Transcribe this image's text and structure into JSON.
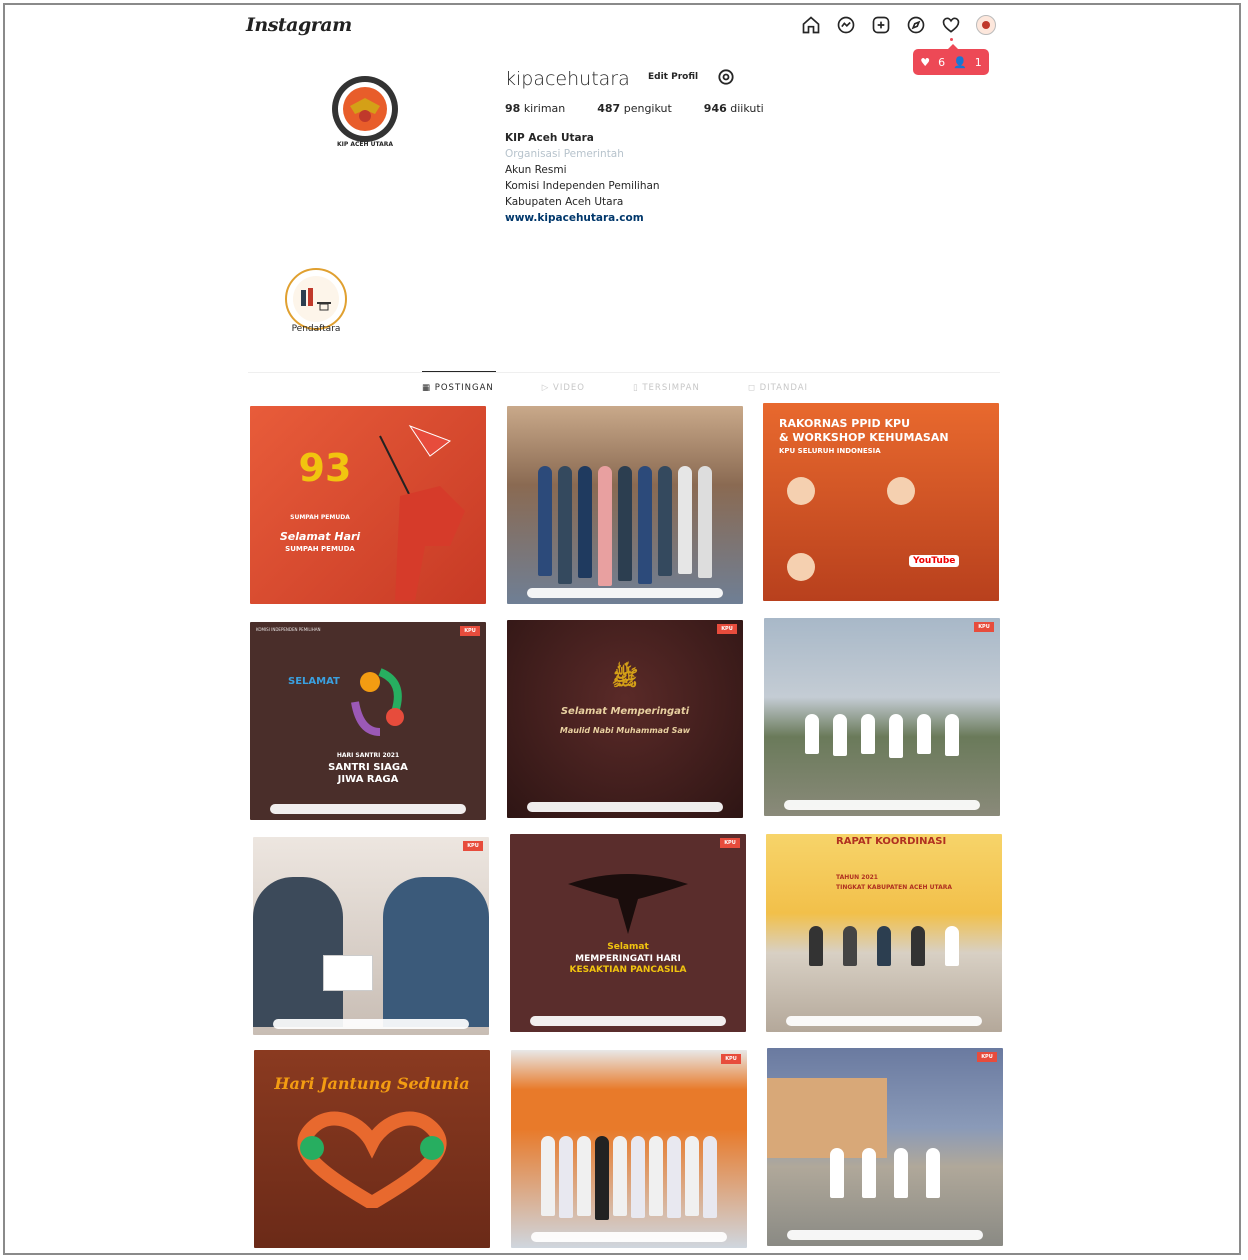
{
  "app": {
    "logo": "Instagram"
  },
  "nav": {
    "icons": [
      "home-icon",
      "messenger-icon",
      "new-post-icon",
      "explore-icon",
      "activity-heart-icon",
      "avatar"
    ]
  },
  "notification": {
    "likes": "6",
    "follows": "1"
  },
  "profile": {
    "username": "kipacehutara",
    "edit_label": "Edit Profil",
    "avatar_caption": "KIP ACEH UTARA",
    "stats": {
      "posts_count": "98",
      "posts_label": "kiriman",
      "followers_count": "487",
      "followers_label": "pengikut",
      "following_count": "946",
      "following_label": "diikuti"
    },
    "bio": {
      "name": "KIP Aceh Utara",
      "category": "Organisasi Pemerintah",
      "line1": "Akun Resmi",
      "line2": "Komisi Independen Pemilihan",
      "line3": "Kabupaten Aceh Utara",
      "link": "www.kipacehutara.com"
    }
  },
  "highlight": {
    "label": "Pendaftara"
  },
  "tabs": [
    {
      "label": "POSTINGAN",
      "active": true
    },
    {
      "label": "VIDEO",
      "active": false
    },
    {
      "label": "TERSIMPAN",
      "active": false
    },
    {
      "label": "DITANDAI",
      "active": false
    }
  ],
  "posts": {
    "p1": {
      "num": "93",
      "line1": "SUMPAH PEMUDA",
      "line2": "Selamat Hari",
      "line3": "SUMPAH PEMUDA"
    },
    "p3": {
      "line1": "RAKORNAS PPID KPU",
      "line2": "& WORKSHOP KEHUMASAN",
      "line3": "KPU SELURUH INDONESIA",
      "yt": "YouTube"
    },
    "p4": {
      "line1": "SELAMAT",
      "line2": "HARI SANTRI 2021",
      "line3": "SANTRI SIAGA",
      "line4": "JIWA RAGA"
    },
    "p5": {
      "line1": "Selamat Memperingati",
      "line2": "Maulid Nabi Muhammad Saw"
    },
    "p8": {
      "line1": "Selamat",
      "line2": "MEMPERINGATI HARI",
      "line3": "KESAKTIAN PANCASILA"
    },
    "p9": {
      "line1": "RAPAT KOORDINASI",
      "line2": "TAHUN 2021",
      "line3": "TINGKAT KABUPATEN ACEH UTARA"
    },
    "p10": {
      "line1": "Hari Jantung Sedunia"
    }
  }
}
